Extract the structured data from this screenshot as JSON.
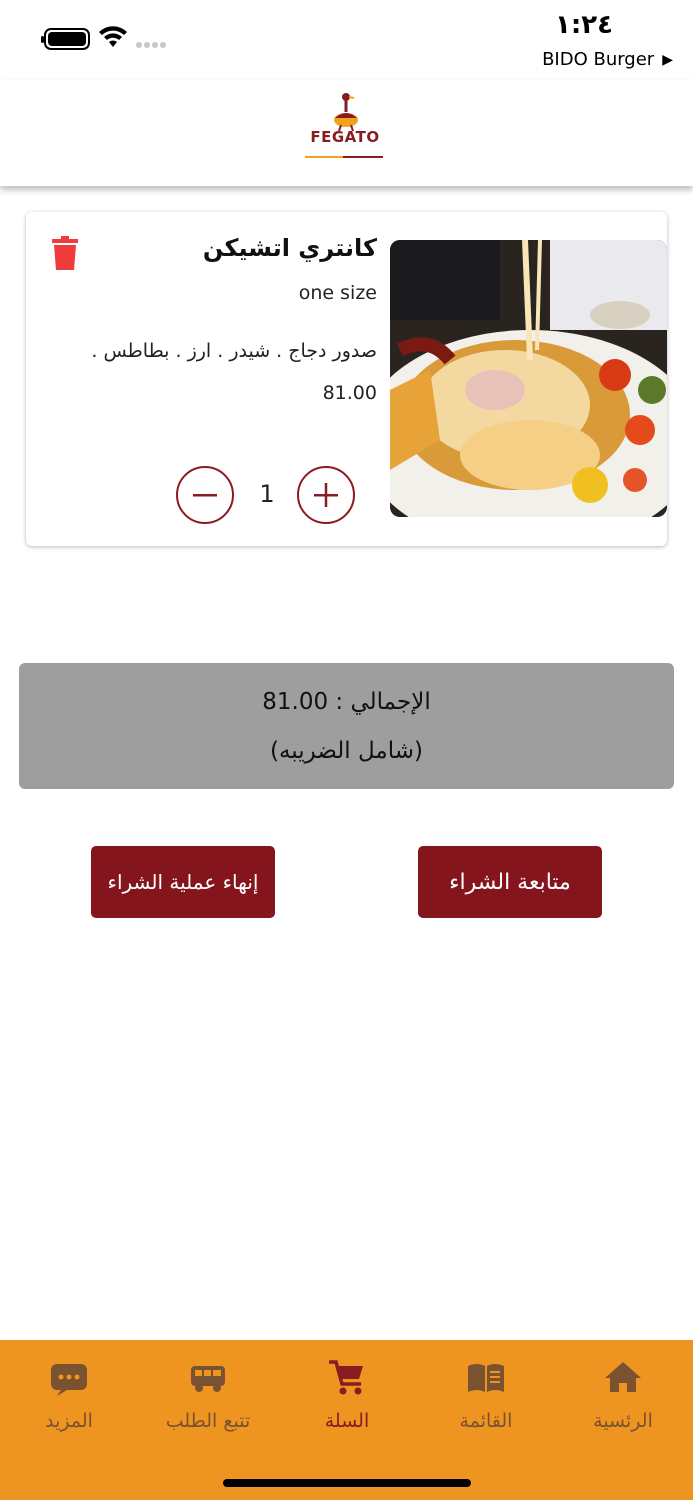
{
  "status_bar": {
    "time": "١:٢٤",
    "back_app": "BIDO Burger",
    "back_icon": "play-triangle-icon"
  },
  "header": {
    "logo_text": "FEGATO"
  },
  "cart_item": {
    "name": "كانتري اتشيكن",
    "size": "one size",
    "description": "صدور دجاج . شيدر . ارز . بطاطس .",
    "price": "81.00",
    "quantity": "1",
    "delete_icon": "trash-icon",
    "minus_icon": "minus-icon",
    "plus_icon": "plus-icon"
  },
  "summary": {
    "total_line": "الإجمالي : 81.00",
    "tax_note": "(شامل الضريبه)"
  },
  "actions": {
    "finish_label": "إنهاء عملية الشراء",
    "continue_label": "متابعة الشراء"
  },
  "bottom_nav": {
    "items": [
      {
        "label": "المزيد",
        "icon": "more-icon"
      },
      {
        "label": "تتبع الطلب",
        "icon": "delivery-truck-icon"
      },
      {
        "label": "السلة",
        "icon": "cart-icon"
      },
      {
        "label": "القائمة",
        "icon": "menu-book-icon"
      },
      {
        "label": "الرئسية",
        "icon": "home-icon"
      }
    ],
    "active_index": 2
  },
  "colors": {
    "brand": "#85151c",
    "nav_bg": "#ee9420",
    "total_bg": "#9e9e9e",
    "delete": "#ef3b3b"
  }
}
